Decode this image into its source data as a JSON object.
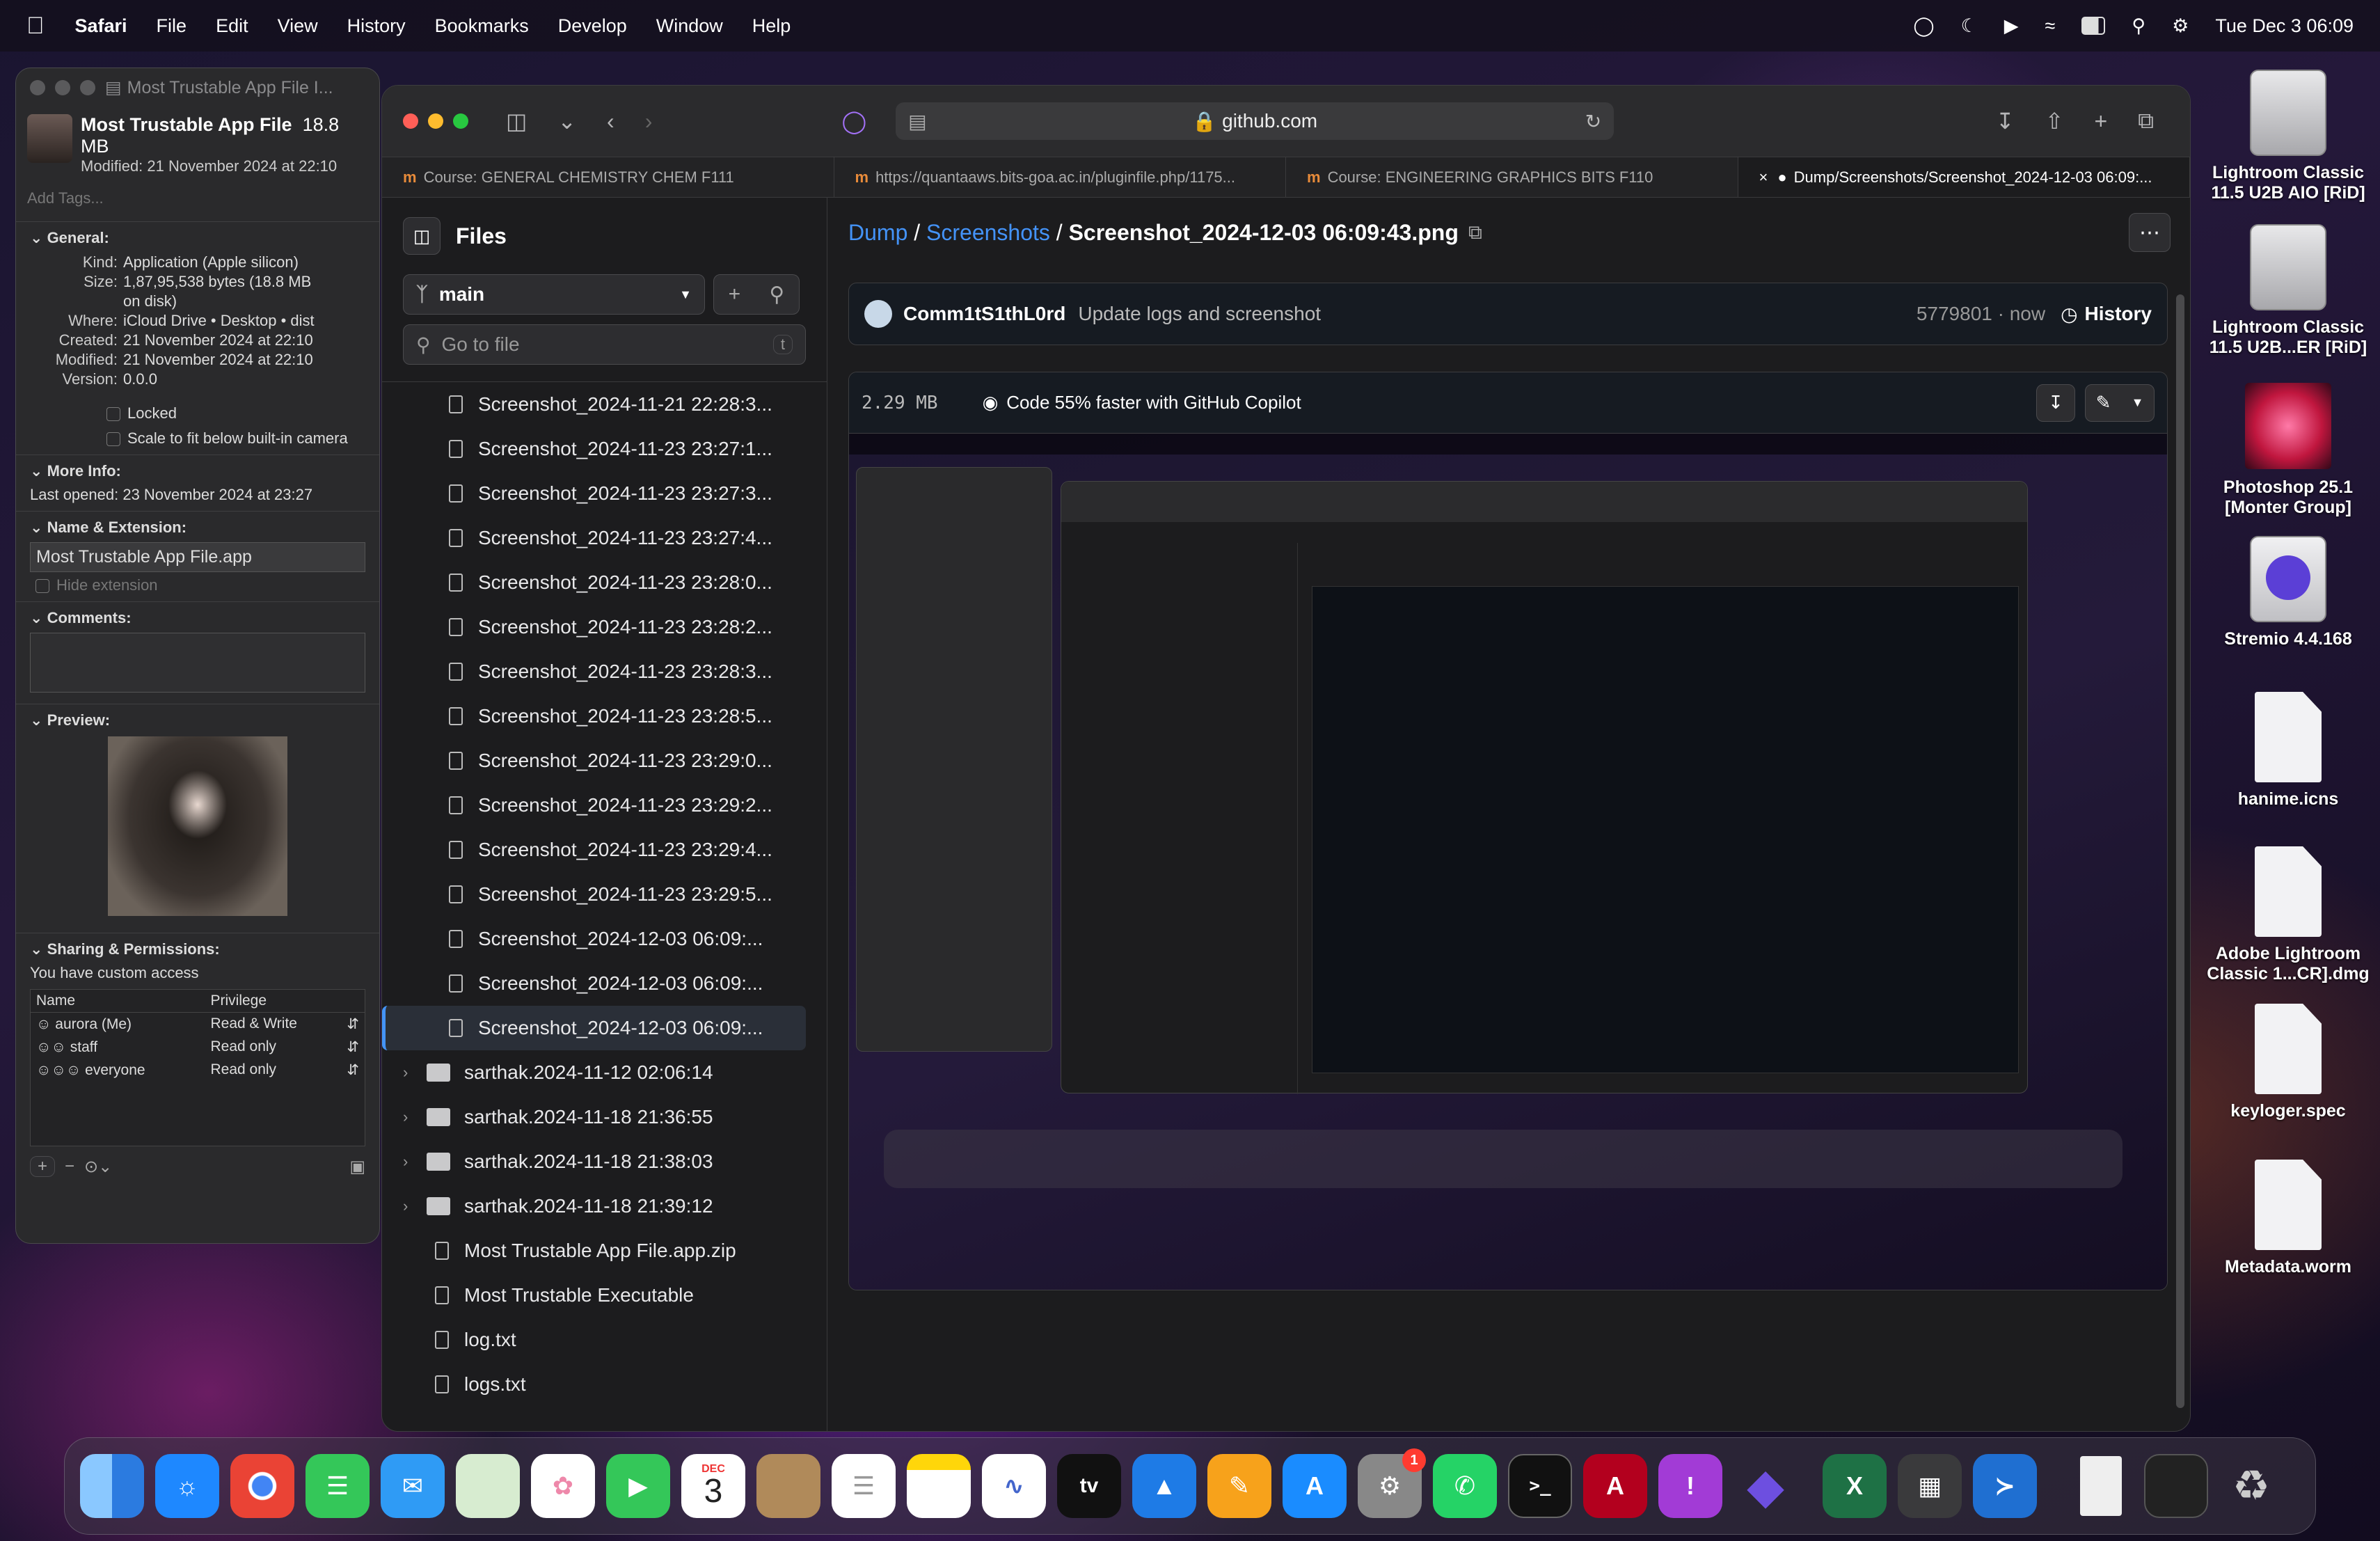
{
  "menubar": {
    "app_name": "Safari",
    "items": [
      "File",
      "Edit",
      "View",
      "History",
      "Bookmarks",
      "Develop",
      "Window",
      "Help"
    ],
    "clock": "Tue Dec 3  06:09"
  },
  "info": {
    "title": "Most Trustable App File I...",
    "file_name": "Most Trustable App File",
    "file_size": "18.8 MB",
    "modified_line": "Modified: 21 November 2024 at 22:10",
    "tags_placeholder": "Add Tags...",
    "general_header": "General:",
    "kind_k": "Kind:",
    "kind_v": "Application (Apple silicon)",
    "size_k": "Size:",
    "size_v": "1,87,95,538 bytes (18.8 MB",
    "size_v2": "on disk)",
    "where_k": "Where:",
    "where_v": "iCloud Drive • Desktop • dist",
    "created_k": "Created:",
    "created_v": "21 November 2024 at 22:10",
    "modified_k": "Modified:",
    "modified_v": "21 November 2024 at 22:10",
    "version_k": "Version:",
    "version_v": "0.0.0",
    "locked": "Locked",
    "scale": "Scale to fit below built-in camera",
    "more_info_header": "More Info:",
    "last_opened": "Last opened: 23 November 2024 at 23:27",
    "name_ext_header": "Name & Extension:",
    "name_value": "Most Trustable App File.app",
    "hide_ext": "Hide extension",
    "comments_header": "Comments:",
    "preview_header": "Preview:",
    "sharing_header": "Sharing & Permissions:",
    "custom_access": "You have custom access",
    "col_name": "Name",
    "col_priv": "Privilege",
    "perms": [
      {
        "name": "aurora (Me)",
        "priv": "Read & Write"
      },
      {
        "name": "staff",
        "priv": "Read only"
      },
      {
        "name": "everyone",
        "priv": "Read only"
      }
    ]
  },
  "browser": {
    "url": "github.com",
    "tabs": [
      "Course: GENERAL CHEMISTRY CHEM F111",
      "https://quantaaws.bits-goa.ac.in/pluginfile.php/1175...",
      "Course: ENGINEERING GRAPHICS BITS F110",
      "Dump/Screenshots/Screenshot_2024-12-03 06:09:..."
    ]
  },
  "tree": {
    "title": "Files",
    "branch": "main",
    "goto_placeholder": "Go to file",
    "goto_key": "t",
    "files": [
      "Screenshot_2024-11-21 22:28:3...",
      "Screenshot_2024-11-23 23:27:1...",
      "Screenshot_2024-11-23 23:27:3...",
      "Screenshot_2024-11-23 23:27:4...",
      "Screenshot_2024-11-23 23:28:0...",
      "Screenshot_2024-11-23 23:28:2...",
      "Screenshot_2024-11-23 23:28:3...",
      "Screenshot_2024-11-23 23:28:5...",
      "Screenshot_2024-11-23 23:29:0...",
      "Screenshot_2024-11-23 23:29:2...",
      "Screenshot_2024-11-23 23:29:4...",
      "Screenshot_2024-11-23 23:29:5...",
      "Screenshot_2024-12-03 06:09:...",
      "Screenshot_2024-12-03 06:09:...",
      "Screenshot_2024-12-03 06:09:..."
    ],
    "folders": [
      "sarthak.2024-11-12 02:06:14",
      "sarthak.2024-11-18 21:36:55",
      "sarthak.2024-11-18 21:38:03",
      "sarthak.2024-11-18 21:39:12"
    ],
    "root_files": [
      "Most Trustable App File.app.zip",
      "Most Trustable Executable",
      "log.txt",
      "logs.txt"
    ]
  },
  "main": {
    "crumb_repo": "Dump",
    "crumb_dir": "Screenshots",
    "crumb_file": "Screenshot_2024-12-03 06:09:43.png",
    "commit_author": "Comm1tS1thL0rd",
    "commit_msg": "Update logs and screenshot",
    "commit_sha": "5779801 · now",
    "history": "History",
    "file_size": "2.29 MB",
    "copilot": "Code 55% faster with GitHub Copilot"
  },
  "desktop": [
    {
      "label": "Lightroom Classic 11.5 U2B AIO [RiD]",
      "icon": "disk-icon"
    },
    {
      "label": "Lightroom Classic 11.5 U2B...ER [RiD]",
      "icon": "disk-icon"
    },
    {
      "label": "Photoshop 25.1 [Monter Group]",
      "icon": "flower-icon"
    },
    {
      "label": "Stremio 4.4.168",
      "icon": "stremio-icon"
    },
    {
      "label": "hanime.icns",
      "icon": "icns-icon"
    },
    {
      "label": "Adobe Lightroom Classic 1...CR].dmg",
      "icon": "dmg-icon"
    },
    {
      "label": "keyloger.spec",
      "icon": "document-icon"
    },
    {
      "label": "Metadata.worm",
      "icon": "document-icon"
    }
  ],
  "dock": {
    "calendar_month": "DEC",
    "calendar_day": "3",
    "settings_badge": "1",
    "tv": "tv"
  }
}
